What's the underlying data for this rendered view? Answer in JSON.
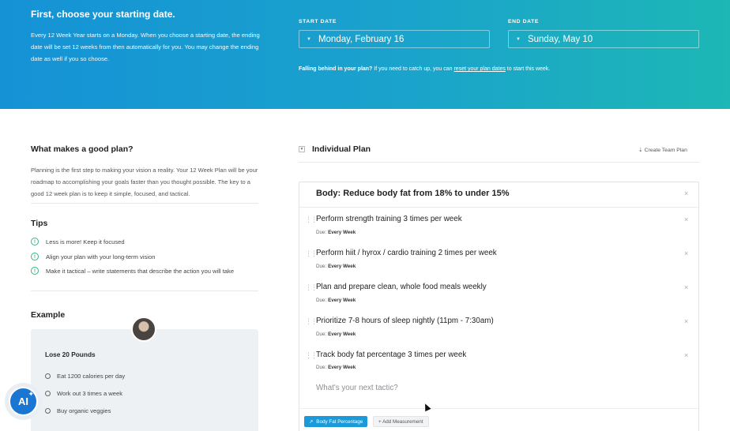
{
  "header": {
    "title": "First, choose your starting date.",
    "description": "Every 12 Week Year starts on a Monday. When you choose a starting date, the ending date will be set 12 weeks from then automatically for you. You may change the ending date as well if you so choose.",
    "start_label": "START DATE",
    "start_value": "Monday, February 16",
    "end_label": "END DATE",
    "end_value": "Sunday, May 10",
    "behind_bold": "Falling behind in your plan?",
    "behind_text": " If you need to catch up, you can ",
    "behind_link": "reset your plan dates",
    "behind_tail": " to start this week."
  },
  "left": {
    "good_plan_title": "What makes a good plan?",
    "good_plan_text": "Planning is the first step to making your vision a reality. Your 12 Week Plan will be your roadmap to accomplishing your goals faster than you thought possible. The key to a good 12 week plan is to keep it simple, focused, and tactical.",
    "tips_title": "Tips",
    "tips": [
      "Less is more! Keep it focused",
      "Align your plan with your long-term vision",
      "Make it tactical – write statements that describe the action you will take"
    ],
    "example_title": "Example",
    "example": {
      "goal": "Lose 20 Pounds",
      "items": [
        "Eat 1200 calories per day",
        "Work out 3 times a week",
        "Buy organic veggies"
      ]
    }
  },
  "plan": {
    "title": "Individual Plan",
    "create_team": "Create Team Plan",
    "goal": "Body: Reduce body fat from 18% to under 15%",
    "due_label": "Due:",
    "tactics": [
      {
        "text": "Perform strength training 3 times per week",
        "due": "Every Week"
      },
      {
        "text": "Perform hiit / hyrox / cardio training 2 times per week",
        "due": "Every Week"
      },
      {
        "text": "Plan and prepare clean, whole food meals weekly",
        "due": "Every Week"
      },
      {
        "text": "Prioritize 7-8 hours of sleep nightly (11pm - 7:30am)",
        "due": "Every Week"
      },
      {
        "text": "Track body fat percentage 3 times per week",
        "due": "Every Week"
      }
    ],
    "next_placeholder": "What's your next tactic?",
    "measure_button": "Body Fat Percentage",
    "add_measurement": "+ Add Measurement"
  },
  "ai_badge": "AI",
  "colors": {
    "accent": "#1a9ad9",
    "tip_green": "#36b37e"
  }
}
